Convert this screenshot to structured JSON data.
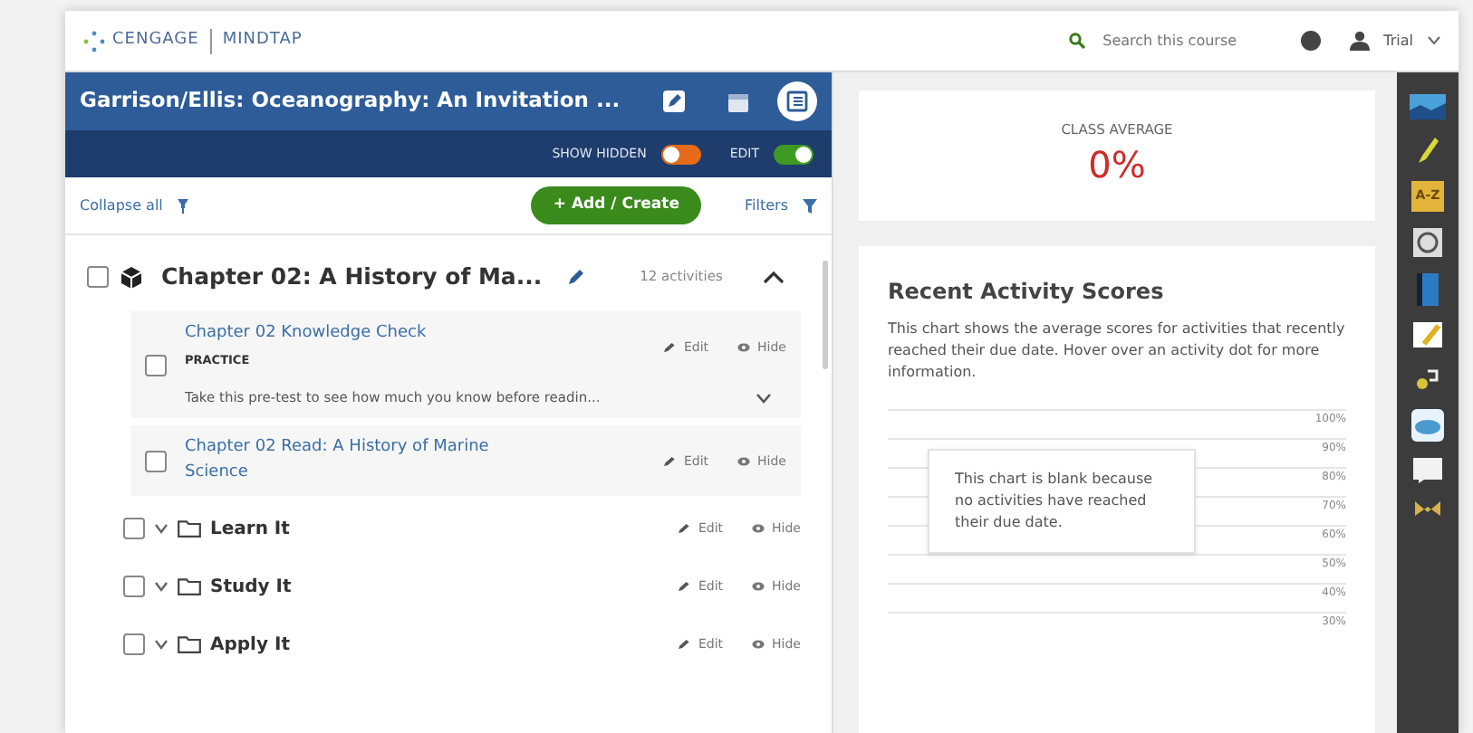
{
  "top_bar": {
    "brand": "CENGAGE",
    "product": "MINDTAP",
    "search": {
      "placeholder": "Search this course"
    },
    "user": "Trial"
  },
  "course": {
    "title": "Garrison/Ellis: Oceanography: An Invitation ...",
    "show_hidden": {
      "label": "SHOW HIDDEN",
      "on": false
    },
    "edit": {
      "label": "EDIT",
      "on": true
    }
  },
  "toolbar": {
    "collapse": "Collapse all",
    "add": "+ Add / Create",
    "filters": "Filters"
  },
  "chapter": {
    "title": "Chapter 02: A History of Ma...",
    "count": "12 activities",
    "checked": false,
    "expanded": true
  },
  "items": [
    {
      "kind": "activity",
      "title": "Chapter 02 Knowledge Check",
      "tag": "PRACTICE",
      "description": "Take this pre-test to see how much you know before readin...",
      "checked": false,
      "edit": "Edit",
      "hide": "Hide"
    },
    {
      "kind": "activity",
      "title": "Chapter 02 Read: A History of Marine Science",
      "checked": false,
      "edit": "Edit",
      "hide": "Hide"
    },
    {
      "kind": "folder",
      "title": "Learn It",
      "checked": false,
      "expanded": false,
      "edit": "Edit",
      "hide": "Hide"
    },
    {
      "kind": "folder",
      "title": "Study It",
      "checked": false,
      "expanded": false,
      "edit": "Edit",
      "hide": "Hide"
    },
    {
      "kind": "folder",
      "title": "Apply It",
      "checked": false,
      "expanded": false,
      "edit": "Edit",
      "hide": "Hide"
    }
  ],
  "class_average": {
    "label": "CLASS AVERAGE",
    "value": "0%"
  },
  "recent_scores": {
    "title": "Recent Activity Scores",
    "description": "This chart shows the average scores for activities that recently reached their due date. Hover over an activity dot for more information.",
    "tick_labels": [
      "100%",
      "90%",
      "80%",
      "70%",
      "60%",
      "50%",
      "40%",
      "30%"
    ],
    "message": "This chart is blank because no activities have reached their due date."
  },
  "app_dock": {
    "dictionary_label": "A-Z"
  }
}
